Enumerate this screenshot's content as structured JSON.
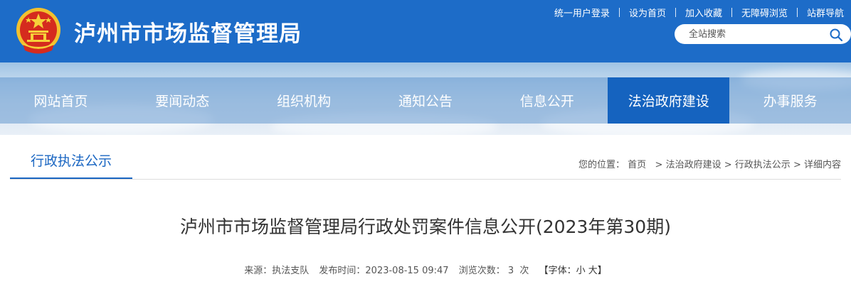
{
  "header": {
    "site_title": "泸州市市场监督管理局",
    "top_links": [
      "统一用户登录",
      "设为首页",
      "加入收藏",
      "无障碍浏览",
      "站群导航"
    ],
    "search_placeholder": "全站搜索",
    "colors": {
      "header_bg": "#1d6cc8",
      "nav_active": "#1563bf",
      "accent": "#1a66c2"
    },
    "emblem_icon": "national-emblem-icon"
  },
  "nav": {
    "items": [
      "网站首页",
      "要闻动态",
      "组织机构",
      "通知公告",
      "信息公开",
      "法治政府建设",
      "办事服务"
    ],
    "active": "法治政府建设"
  },
  "section": {
    "title": "行政执法公示",
    "breadcrumb_label": "您的位置：",
    "breadcrumb": [
      "首页",
      "法治政府建设",
      "行政执法公示",
      "详细内容"
    ]
  },
  "article": {
    "title": "泸州市市场监督管理局行政处罚案件信息公开(2023年第30期)",
    "source_label": "来源：",
    "source": "执法支队",
    "time_label": "发布时间：",
    "time": "2023-08-15 09:47",
    "views_label": "浏览次数：",
    "views": "3",
    "views_unit": "次",
    "font_label": "【字体：",
    "font_small": "小",
    "font_large": "大",
    "font_close": "】"
  }
}
